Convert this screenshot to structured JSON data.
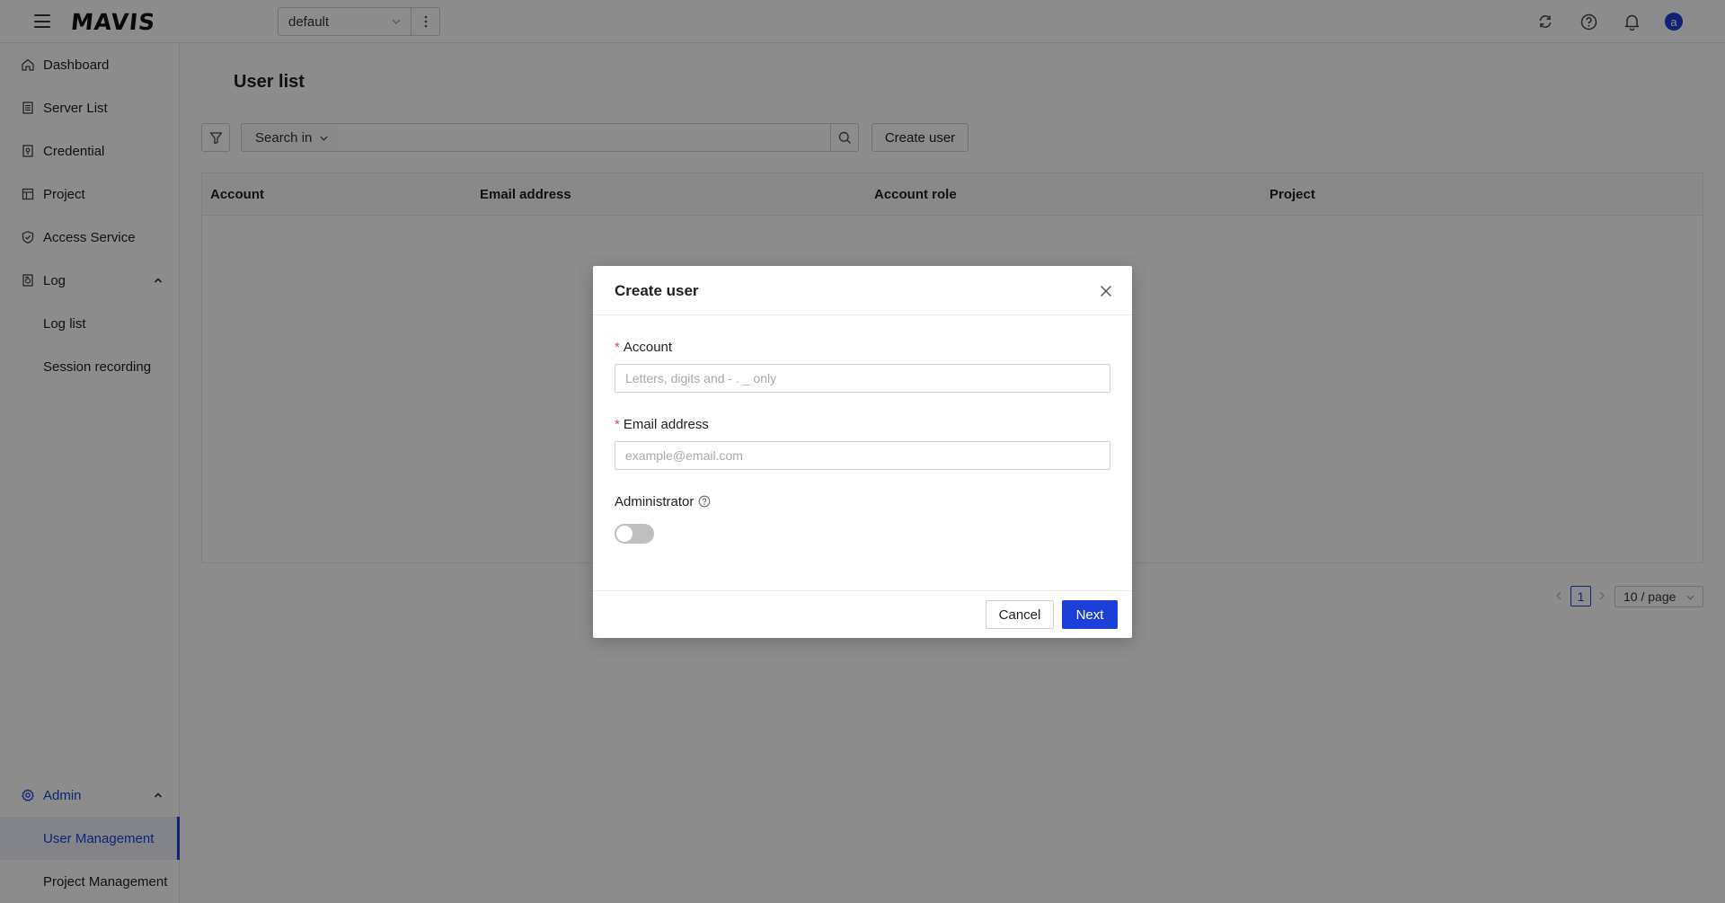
{
  "header": {
    "logo": "MAVIS",
    "project_select": "default",
    "avatar_initial": "a",
    "icons": [
      "hamburger-icon",
      "more-vertical-icon",
      "refresh-icon",
      "help-icon",
      "bell-icon"
    ]
  },
  "sidebar": {
    "items": [
      {
        "label": "Dashboard",
        "icon": "home-icon"
      },
      {
        "label": "Server List",
        "icon": "server-icon"
      },
      {
        "label": "Credential",
        "icon": "credential-icon"
      },
      {
        "label": "Project",
        "icon": "project-icon"
      },
      {
        "label": "Access Service",
        "icon": "shield-icon"
      },
      {
        "label": "Log",
        "icon": "log-icon"
      },
      {
        "label": "Log list"
      },
      {
        "label": "Session recording"
      }
    ],
    "admin": {
      "label": "Admin",
      "icon": "gear-icon",
      "children": [
        {
          "label": "User Management"
        },
        {
          "label": "Project Management"
        }
      ]
    }
  },
  "main": {
    "title": "User list",
    "search_in_label": "Search in",
    "search_value": "",
    "create_user_label": "Create user",
    "table": {
      "columns": [
        "Account",
        "Email address",
        "Account role",
        "Project"
      ]
    },
    "pagination": {
      "current_page": "1",
      "page_size": "10 / page"
    }
  },
  "modal": {
    "title": "Create user",
    "account_label": "Account",
    "account_placeholder": "Letters, digits and - . _ only",
    "account_value": "",
    "email_label": "Email address",
    "email_placeholder": "example@email.com",
    "email_value": "",
    "admin_label": "Administrator",
    "admin_enabled": false,
    "cancel_label": "Cancel",
    "next_label": "Next"
  },
  "colors": {
    "accent": "#1d3fd8",
    "required": "#e5484d",
    "overlay": "rgba(0,0,0,0.45)"
  }
}
